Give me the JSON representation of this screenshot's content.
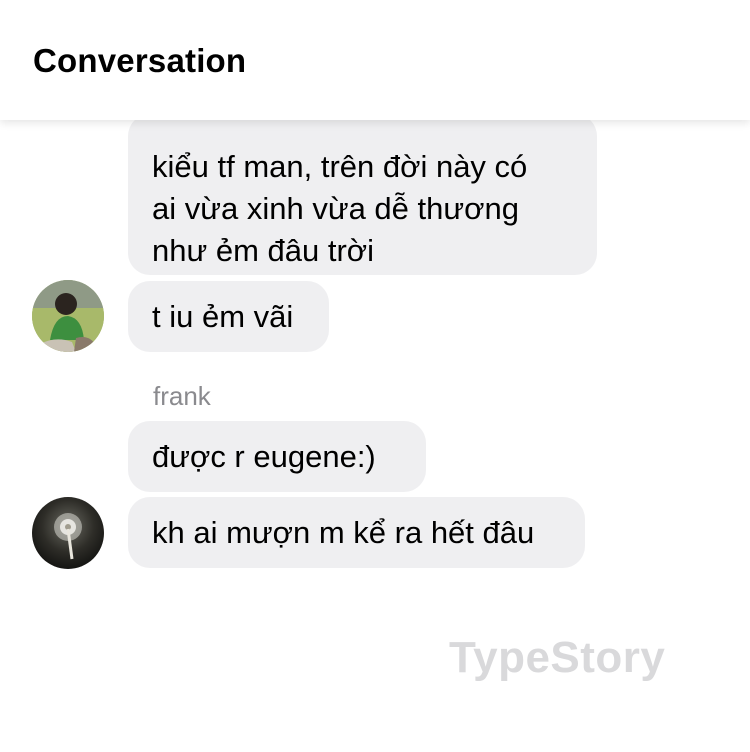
{
  "header": {
    "title": "Conversation"
  },
  "messages": [
    {
      "text": "kiểu tf man, trên đời này có\nai vừa xinh vừa dễ thương\nnhư ẻm đâu trời"
    },
    {
      "text": "t iu ẻm vãi"
    },
    {
      "text": "được r eugene:)"
    },
    {
      "text": "kh ai mượn m kể ra hết đâu"
    }
  ],
  "sender": {
    "name": "frank"
  },
  "watermark": "TypeStory",
  "colors": {
    "bubble": "#efeff1",
    "sender_name": "#8a8a8e",
    "watermark": "#d9d9db"
  }
}
